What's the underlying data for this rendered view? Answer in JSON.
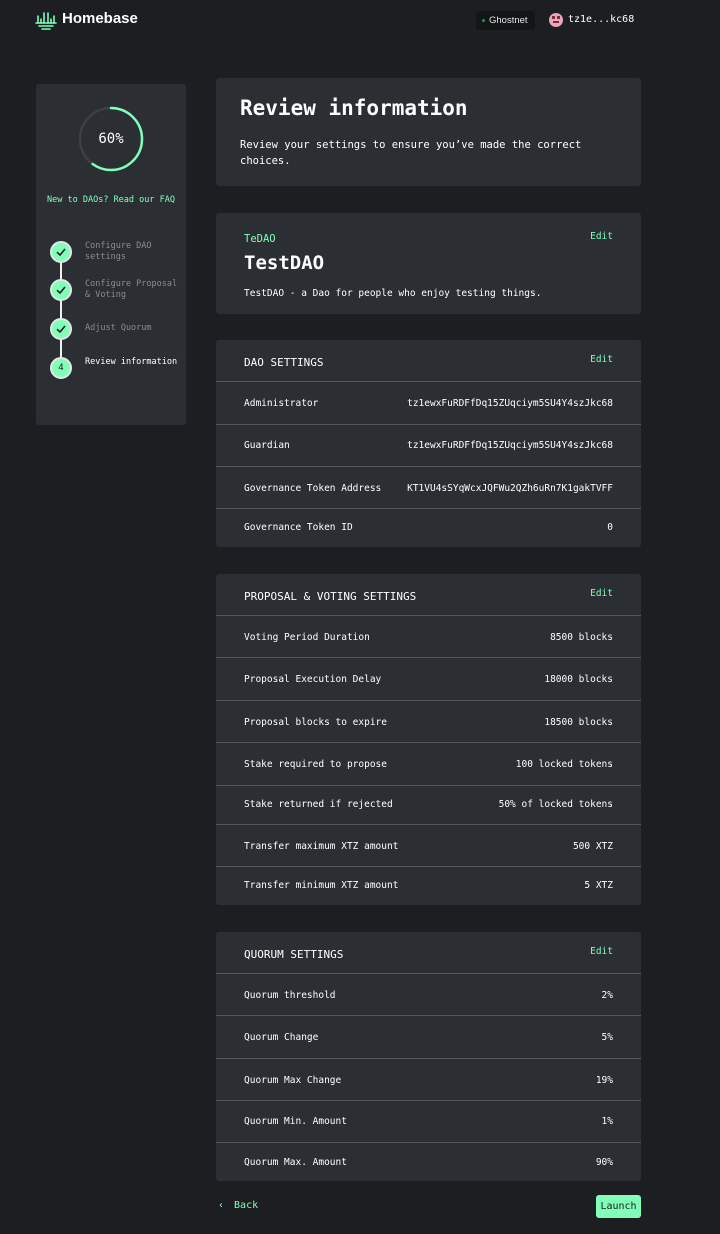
{
  "header": {
    "brand": "Homebase",
    "network": "Ghostnet",
    "wallet_address": "tz1e...kc68"
  },
  "sidebar": {
    "progress_percent": 60,
    "progress_label": "60%",
    "faq_text": "New to DAOs? Read our FAQ",
    "steps": [
      {
        "label": "Configure DAO settings",
        "status": "done"
      },
      {
        "label": "Configure Proposal & Voting",
        "status": "done"
      },
      {
        "label": "Adjust Quorum",
        "status": "done"
      },
      {
        "label": "Review information",
        "status": "current",
        "number": "4"
      }
    ]
  },
  "review": {
    "title": "Review information",
    "description": "Review your settings to ensure you’ve made the correct choices."
  },
  "dao": {
    "symbol": "TeDAO",
    "name": "TestDAO",
    "description": "TestDAO - a Dao for people who enjoy testing things.",
    "edit_label": "Edit"
  },
  "dao_settings": {
    "title": "DAO SETTINGS",
    "edit_label": "Edit",
    "rows": [
      {
        "label": "Administrator",
        "value": "tz1ewxFuRDFfDq15ZUqciym5SU4Y4szJkc68"
      },
      {
        "label": "Guardian",
        "value": "tz1ewxFuRDFfDq15ZUqciym5SU4Y4szJkc68"
      },
      {
        "label": "Governance Token Address",
        "value": "KT1VU4sSYqWcxJQFWu2QZh6uRn7K1gakTVFF"
      },
      {
        "label": "Governance Token ID",
        "value": "0"
      }
    ]
  },
  "proposal_settings": {
    "title": "PROPOSAL & VOTING SETTINGS",
    "edit_label": "Edit",
    "rows": [
      {
        "label": "Voting Period Duration",
        "value": "8500 blocks"
      },
      {
        "label": "Proposal Execution Delay",
        "value": "18000 blocks"
      },
      {
        "label": "Proposal blocks to expire",
        "value": "18500 blocks"
      },
      {
        "label": "Stake required to propose",
        "value": "100 locked tokens"
      },
      {
        "label": "Stake returned if rejected",
        "value": "50% of locked tokens"
      },
      {
        "label": "Transfer maximum XTZ amount",
        "value": "500 XTZ"
      },
      {
        "label": "Transfer minimum XTZ amount",
        "value": "5 XTZ"
      }
    ]
  },
  "quorum_settings": {
    "title": "QUORUM SETTINGS",
    "edit_label": "Edit",
    "rows": [
      {
        "label": "Quorum threshold",
        "value": "2%"
      },
      {
        "label": "Quorum Change",
        "value": "5%"
      },
      {
        "label": "Quorum Max Change",
        "value": "19%"
      },
      {
        "label": "Quorum Min. Amount",
        "value": "1%"
      },
      {
        "label": "Quorum Max. Amount",
        "value": "90%"
      }
    ]
  },
  "footer": {
    "back_label": "Back",
    "launch_label": "Launch"
  },
  "colors": {
    "background": "#1c1e21",
    "card": "#2b2e32",
    "accent": "#81feb7",
    "divider": "#55585c"
  }
}
